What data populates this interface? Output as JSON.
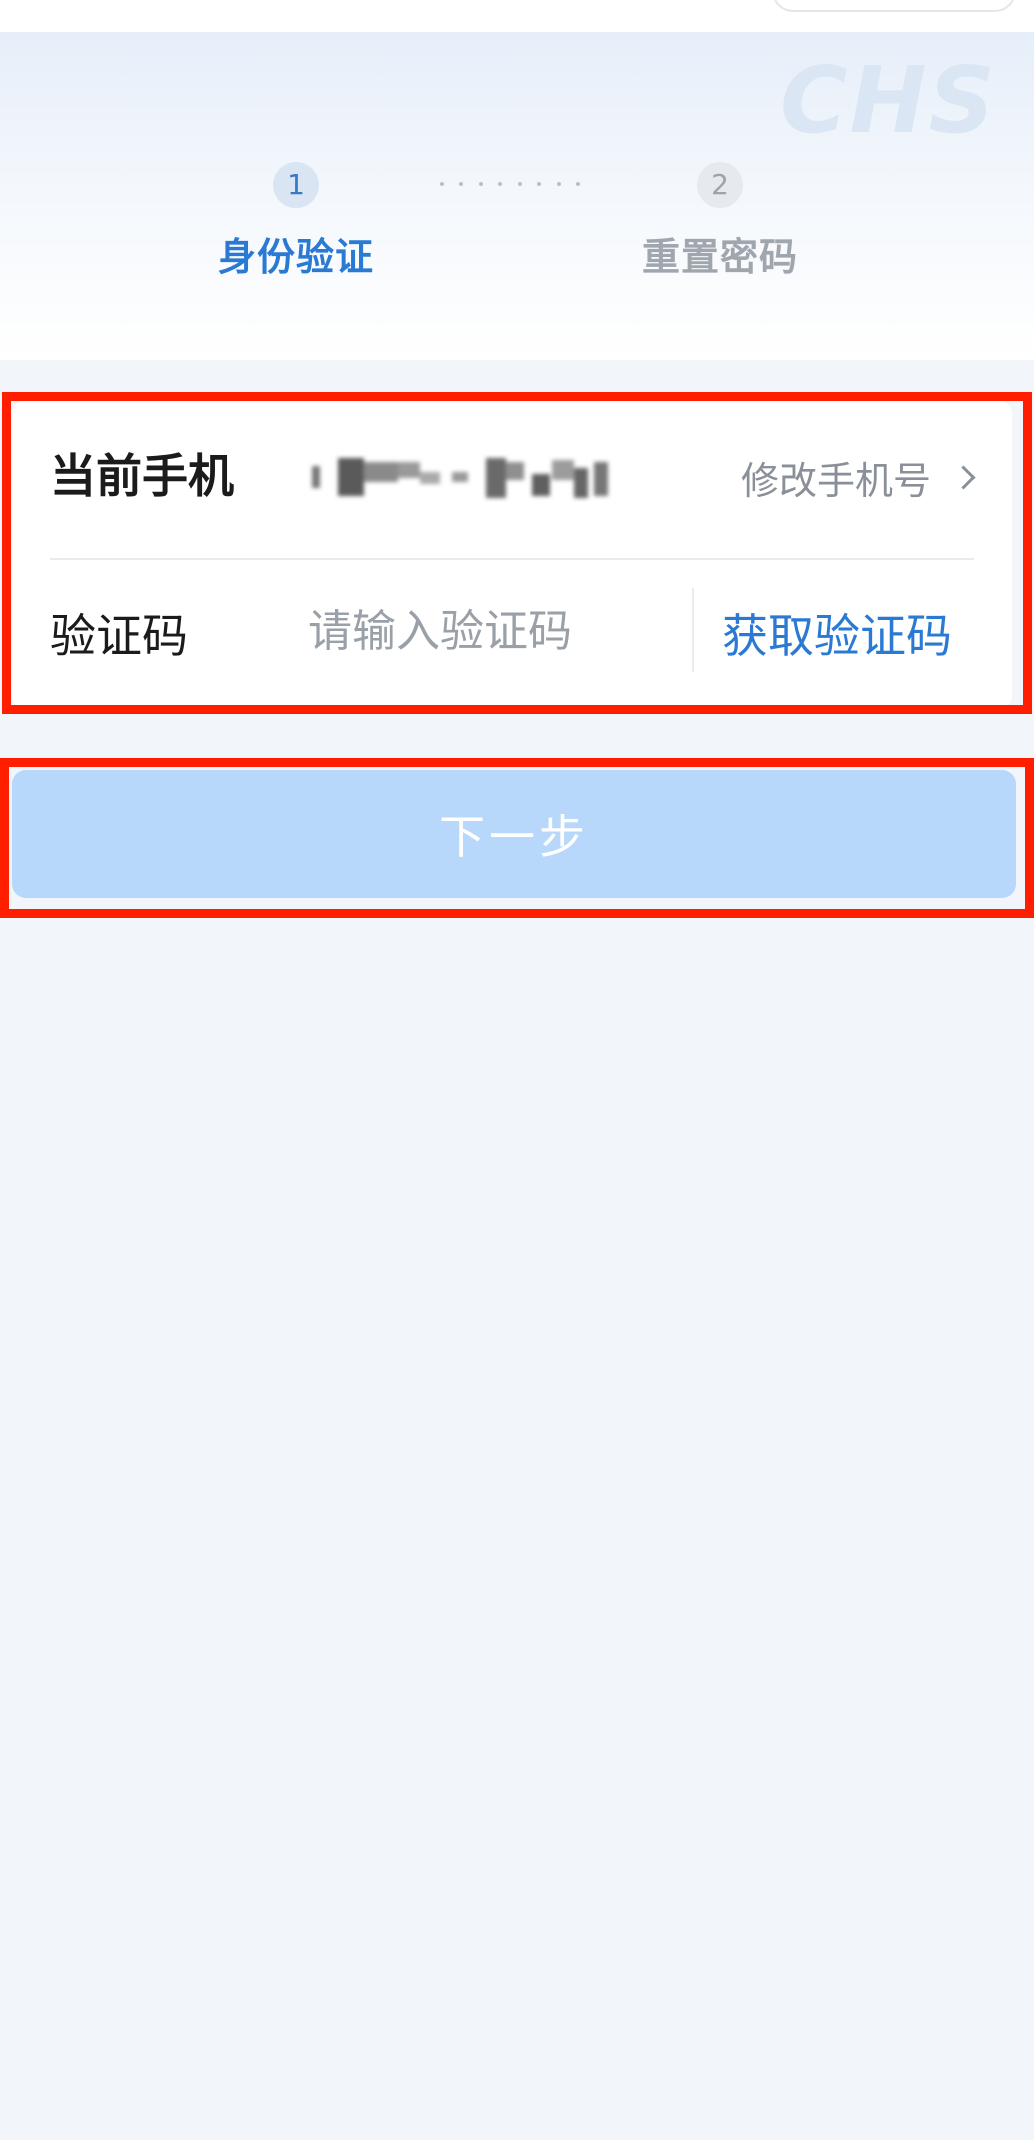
{
  "steps": [
    {
      "number": "1",
      "label": "身份验证",
      "state": "active"
    },
    {
      "number": "2",
      "label": "重置密码",
      "state": "inactive"
    }
  ],
  "watermark_text": "CHS",
  "form": {
    "phone_label": "当前手机",
    "phone_value_masked": true,
    "change_phone_label": "修改手机号",
    "code_label": "验证码",
    "code_placeholder": "请输入验证码",
    "code_value": "",
    "get_code_label": "获取验证码"
  },
  "next_button_label": "下一步",
  "colors": {
    "accent": "#2a7ad4",
    "button_disabled_bg": "#b7d8fb",
    "highlight_border": "#ff1e00",
    "page_bg": "#f2f6fa"
  }
}
